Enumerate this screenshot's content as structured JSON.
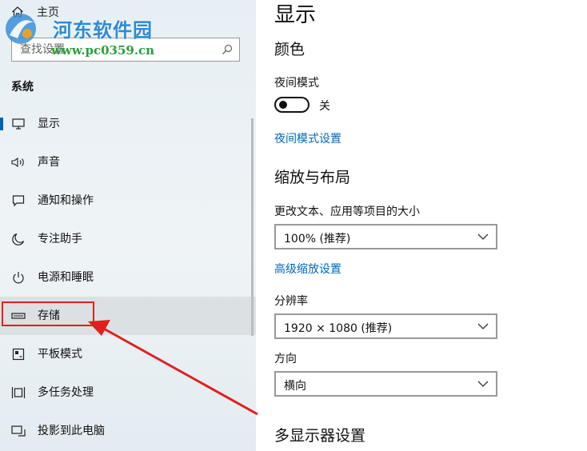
{
  "sidebar": {
    "home_label": "主页",
    "search": {
      "value": "",
      "placeholder": "查找设置"
    },
    "section_title": "系统",
    "items": [
      {
        "label": "显示",
        "icon": "monitor-icon",
        "active": true
      },
      {
        "label": "声音",
        "icon": "speaker-icon"
      },
      {
        "label": "通知和操作",
        "icon": "notification-icon"
      },
      {
        "label": "专注助手",
        "icon": "moon-icon"
      },
      {
        "label": "电源和睡眠",
        "icon": "power-icon"
      },
      {
        "label": "存储",
        "icon": "storage-icon",
        "hovered": true
      },
      {
        "label": "平板模式",
        "icon": "tablet-mode-icon"
      },
      {
        "label": "多任务处理",
        "icon": "multitasking-icon"
      },
      {
        "label": "投影到此电脑",
        "icon": "projection-icon"
      }
    ]
  },
  "watermark": {
    "title": "河东软件园",
    "url": "www.pc0359.cn"
  },
  "main": {
    "page_title": "显示",
    "color_heading": "颜色",
    "night_light_label": "夜间模式",
    "night_light_state": "关",
    "night_light_on": false,
    "night_light_settings_link": "夜间模式设置",
    "scale_layout_heading": "缩放与布局",
    "scale_label": "更改文本、应用等项目的大小",
    "scale_value": "100% (推荐)",
    "advanced_scaling_link": "高级缩放设置",
    "resolution_label": "分辨率",
    "resolution_value": "1920 × 1080 (推荐)",
    "orientation_label": "方向",
    "orientation_value": "横向",
    "multi_display_heading": "多显示器设置"
  },
  "colors": {
    "accent": "#0063b1",
    "link": "#0067b8",
    "highlight_box": "#e02020",
    "annotation_arrow": "#e02020"
  }
}
